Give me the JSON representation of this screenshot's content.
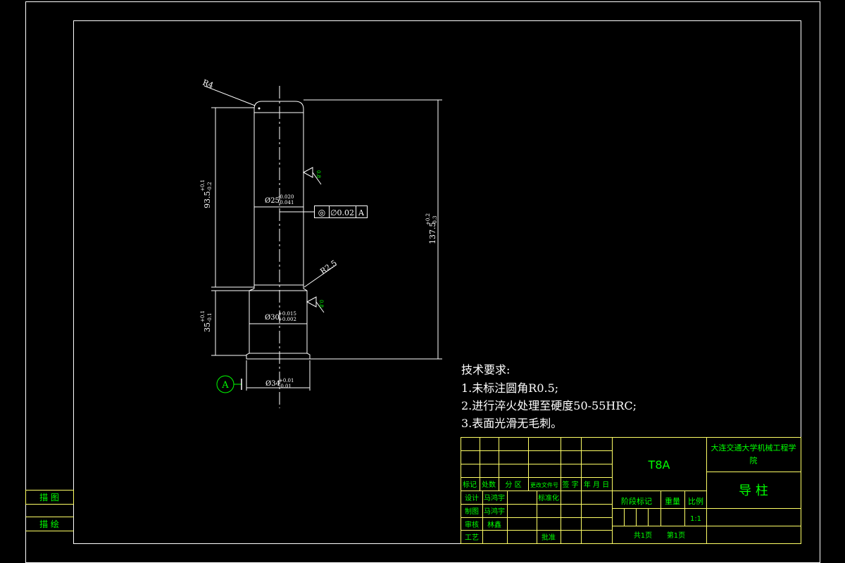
{
  "drawing": {
    "dimensions": {
      "r4": "R4",
      "r25": "R2.5",
      "d25": "Ø25",
      "d25_tol_up": "-0.020",
      "d25_tol_low": "-0.041",
      "d30": "Ø30",
      "d30_tol_up": "+0.015",
      "d30_tol_low": "+0.002",
      "d34": "Ø34",
      "d34_tol_up": "+0.01",
      "d34_tol_low": "-0.01",
      "len935": "93.5",
      "len935_tol_up": "+0.1",
      "len935_tol_low": "-0.2",
      "len35": "35",
      "len35_tol_up": "+0.1",
      "len35_tol_low": "-0.1",
      "len1375": "137.5",
      "len1375_tol_up": "+0.2",
      "len1375_tol_low": "-0.3"
    },
    "tolerance_frame": {
      "symbol": "◎",
      "value": "∅0.02",
      "datum": "A"
    },
    "datum_label": "A",
    "roughness_1": "0.8",
    "roughness_2": "0.8"
  },
  "tech_requirements": {
    "title": "技术要求:",
    "items": [
      "1.未标注圆角R0.5;",
      "2.进行淬火处理至硬度50-55HRC;",
      "3.表面光滑无毛刺。"
    ]
  },
  "left_labels": {
    "trace": "描 图",
    "draw": "描 绘"
  },
  "title_block": {
    "material": "T8A",
    "school": "大连交通大学机械工程学院",
    "part_name": "导 柱",
    "headers": [
      "标记",
      "处数",
      "分 区",
      "更改文件号",
      "签 字",
      "年 月 日"
    ],
    "design_label": "设计",
    "design_name": "马鸿宇",
    "standard_label": "标准化",
    "drafting_label": "制图",
    "drafting_name": "马鸿宇",
    "review_label": "审核",
    "review_name": "林鑫",
    "process_label": "工艺",
    "approve_label": "批准",
    "stage_label": "阶段标记",
    "weight_label": "重量",
    "scale_label": "比例",
    "scale_value": "1:1",
    "total_pages": "共1页",
    "page_no": "第1页"
  },
  "colors": {
    "line": "#ffffff",
    "table_line": "#ffff66",
    "text_green": "#00ff00"
  }
}
